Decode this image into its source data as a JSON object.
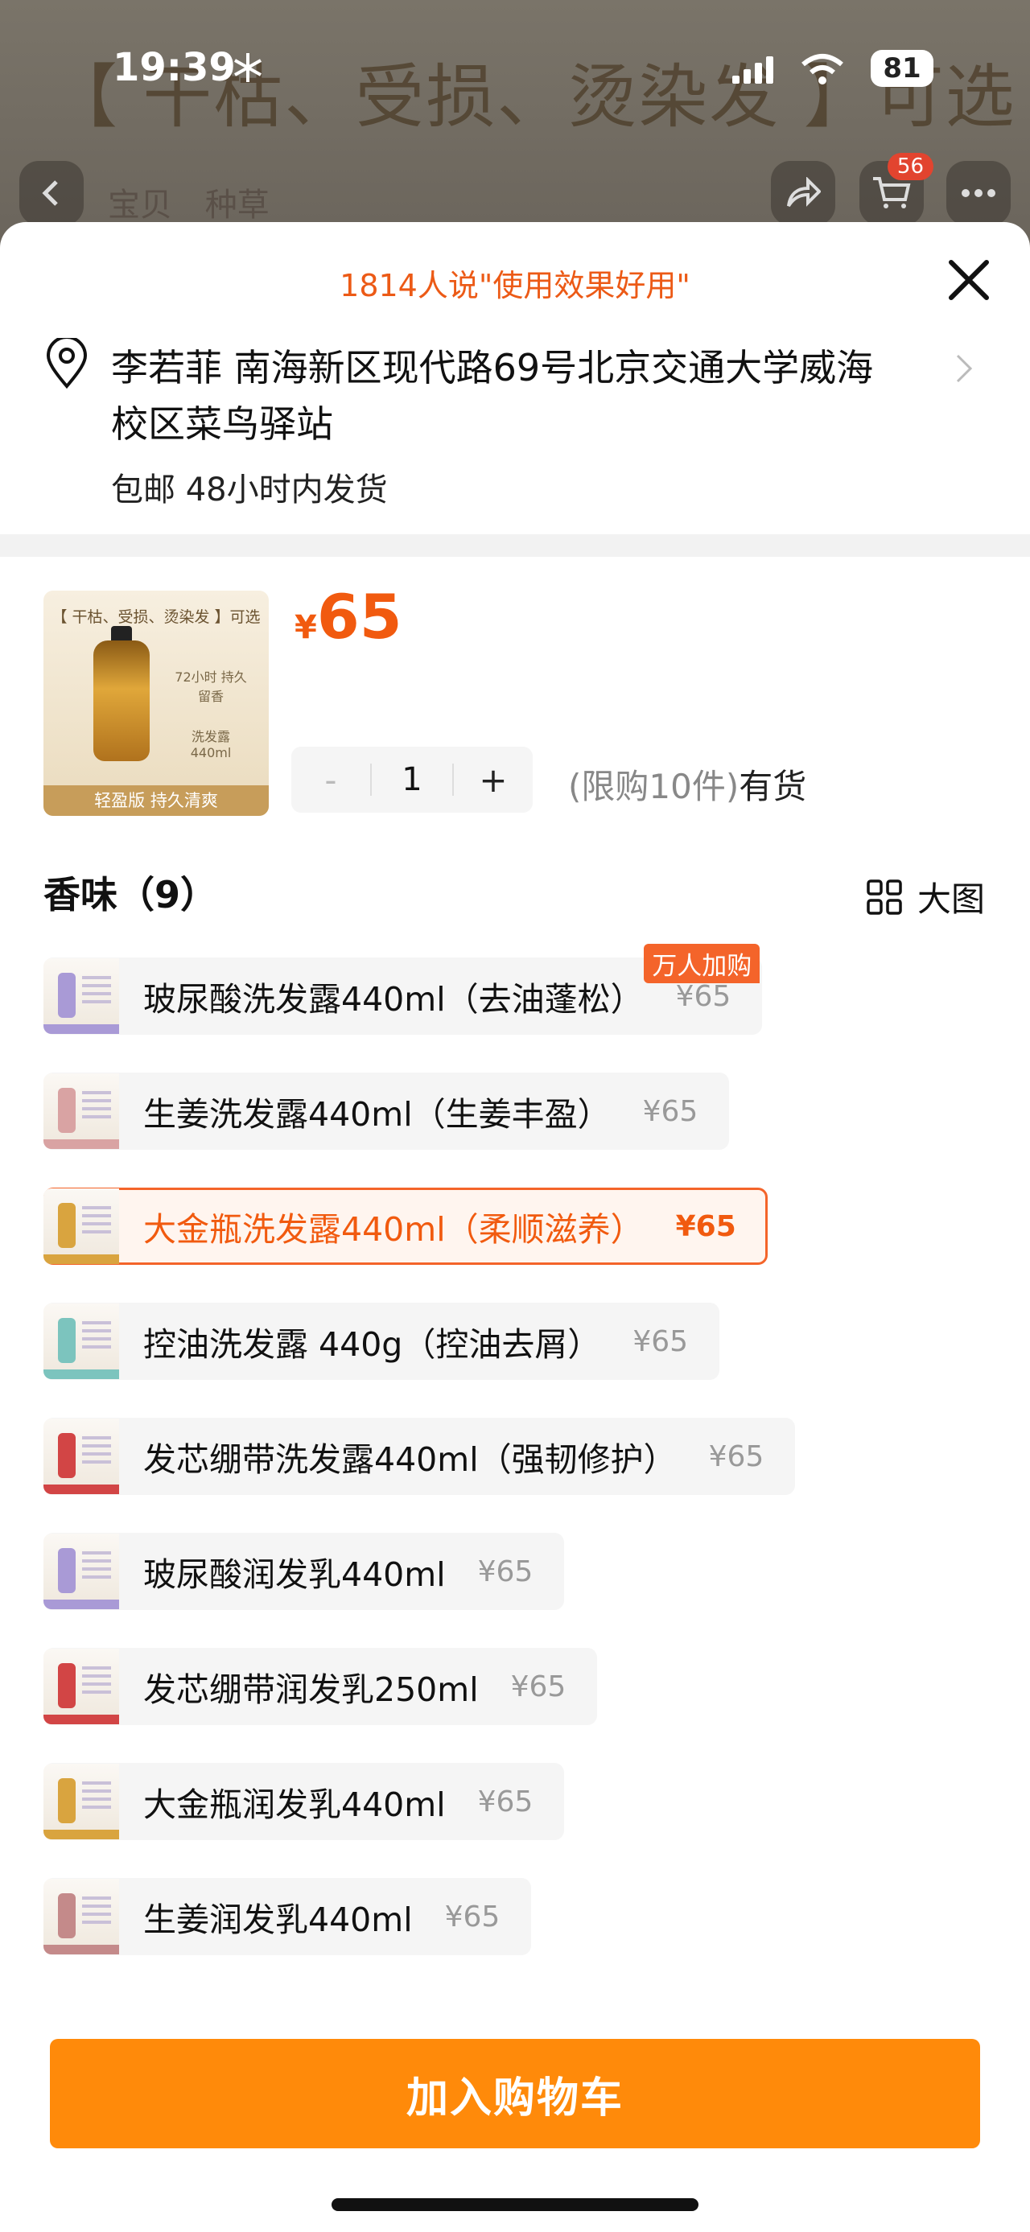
{
  "status_bar": {
    "time": "19:39",
    "battery": "81"
  },
  "background": {
    "banner": "【 干枯、受损、烫染发 】可选",
    "tabs": [
      "宝贝",
      "种草"
    ],
    "cart_count": "56"
  },
  "sheet": {
    "promo": "1814人说\"使用效果好用\"",
    "address": "李若菲 南海新区现代路69号北京交通大学威海校区菜鸟驿站",
    "shipping": "包邮 48小时内发货",
    "product": {
      "thumb_top": "【 干枯、受损、烫染发 】可选",
      "thumb_badge1": "72小时 持久留香",
      "thumb_badge2": "洗发露440ml",
      "thumb_footer": "轻盈版 持久清爽",
      "currency": "¥",
      "price": "65"
    },
    "stepper": {
      "minus": "-",
      "qty": "1",
      "plus": "+"
    },
    "limit_text": "(限购10件)",
    "stock_text": "有货",
    "section_title": "香味（9）",
    "big_view_label": "大图",
    "options": [
      {
        "name": "玻尿酸洗发露440ml（去油蓬松）",
        "price": "¥65",
        "badge": "万人加购",
        "color": "#a99ad6"
      },
      {
        "name": "生姜洗发露440ml（生姜丰盈）",
        "price": "¥65",
        "color": "#d9a3a3"
      },
      {
        "name": "大金瓶洗发露440ml（柔顺滋养）",
        "price": "¥65",
        "selected": true,
        "color": "#d9a43f"
      },
      {
        "name": "控油洗发露 440g（控油去屑）",
        "price": "¥65",
        "color": "#7cc4be"
      },
      {
        "name": "发芯绷带洗发露440ml（强韧修护）",
        "price": "¥65",
        "color": "#d24545"
      },
      {
        "name": "玻尿酸润发乳440ml",
        "price": "¥65",
        "color": "#a99ad6"
      },
      {
        "name": "发芯绷带润发乳250ml",
        "price": "¥65",
        "color": "#d24545"
      },
      {
        "name": "大金瓶润发乳440ml",
        "price": "¥65",
        "color": "#d9a43f"
      },
      {
        "name": "生姜润发乳440ml",
        "price": "¥65",
        "color": "#c48a8a"
      }
    ],
    "add_to_cart": "加入购物车"
  }
}
